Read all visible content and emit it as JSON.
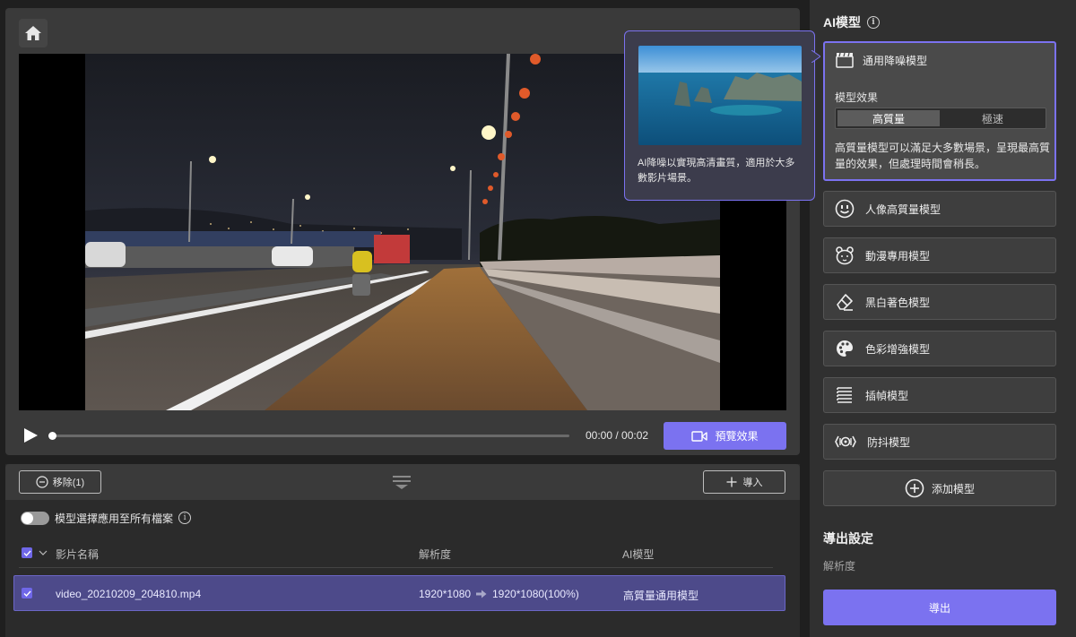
{
  "player": {
    "time_display": "00:00 / 00:02",
    "preview_label": "預覽效果",
    "progress": 0
  },
  "file_list": {
    "remove_label": "移除(1)",
    "import_label": "導入",
    "apply_all_label": "模型選擇應用至所有檔案",
    "columns": {
      "name": "影片名稱",
      "resolution": "解析度",
      "model": "AI模型"
    },
    "rows": [
      {
        "name": "video_20210209_204810.mp4",
        "res_from": "1920*1080",
        "res_to": "1920*1080(100%)",
        "model": "高質量通用模型"
      }
    ]
  },
  "sidebar": {
    "title": "AI模型",
    "active_model": {
      "name": "通用降噪模型",
      "effect_label": "模型效果",
      "options": [
        "高質量",
        "極速"
      ],
      "selected_option": "高質量",
      "description": "高質量模型可以滿足大多數場景，呈現最高質量的效果，但處理時間會稍長。"
    },
    "models": [
      {
        "label": "人像高質量模型",
        "icon": "face-icon"
      },
      {
        "label": "動漫專用模型",
        "icon": "bear-icon"
      },
      {
        "label": "黑白著色模型",
        "icon": "eraser-icon"
      },
      {
        "label": "色彩增強模型",
        "icon": "palette-icon"
      },
      {
        "label": "插幀模型",
        "icon": "frames-icon"
      },
      {
        "label": "防抖模型",
        "icon": "stabilize-icon"
      }
    ],
    "add_model_label": "添加模型",
    "export_title": "導出設定",
    "resolution_label": "解析度",
    "export_button": "導出"
  },
  "tooltip": {
    "text": "AI降噪以實現高清畫質，適用於大多數影片場景。"
  },
  "colors": {
    "accent": "#7b72f0",
    "panel": "#3a3a3a",
    "background": "#1f1f1f"
  }
}
